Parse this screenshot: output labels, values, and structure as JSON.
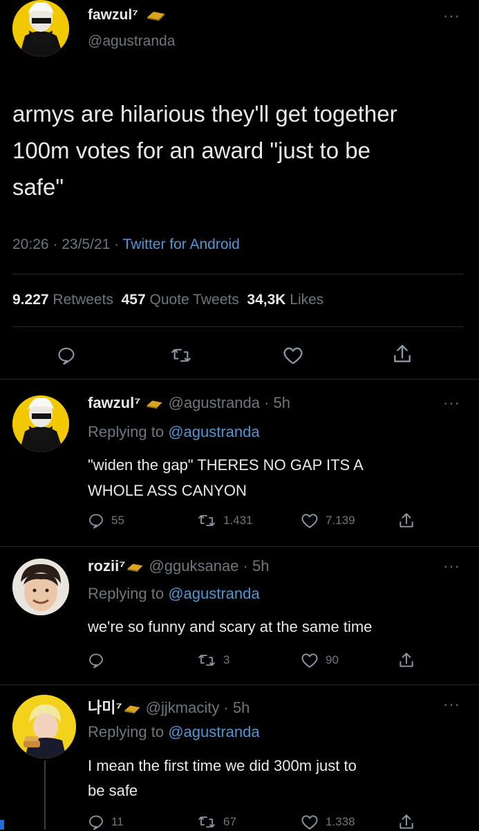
{
  "main_tweet": {
    "display_name": "fawzul⁷",
    "handle": "@agustranda",
    "text_lines": [
      "armys are hilarious they'll get together",
      "100m votes for an award \"just to be",
      "safe\""
    ],
    "time": "20:26",
    "date": "23/5/21",
    "source": "Twitter for Android",
    "stats": {
      "retweets_count": "9.227",
      "retweets_label": "Retweets",
      "quotes_count": "457",
      "quotes_label": "Quote Tweets",
      "likes_count": "34,3K",
      "likes_label": "Likes"
    }
  },
  "replies": [
    {
      "display_name": "fawzul⁷",
      "handle": "@agustranda",
      "age": "5h",
      "replying_prefix": "Replying to",
      "replying_to": "@agustranda",
      "text_lines": [
        "\"widen the gap\" THERES NO GAP ITS A",
        "WHOLE ASS CANYON"
      ],
      "replies_count": "55",
      "retweets_count": "1.431",
      "likes_count": "7.139"
    },
    {
      "display_name": "rozii⁷",
      "handle": "@gguksanae",
      "age": "5h",
      "replying_prefix": "Replying to",
      "replying_to": "@agustranda",
      "text_lines": [
        "we're so funny and scary at the same time"
      ],
      "replies_count": "",
      "retweets_count": "3",
      "likes_count": "90"
    },
    {
      "display_name": "나미⁷",
      "handle": "@jjkmacity",
      "age": "5h",
      "replying_prefix": "Replying to",
      "replying_to": "@agustranda",
      "text_lines": [
        "I mean the first time we did 300m just to",
        "be safe"
      ],
      "replies_count": "11",
      "retweets_count": "67",
      "likes_count": "1.338"
    }
  ],
  "colors": {
    "accent": "#4f96d6",
    "muted": "#6e767d",
    "background": "#000000",
    "gold": "#d9a520"
  },
  "icons": [
    "more-icon",
    "reply-icon",
    "retweet-icon",
    "like-icon",
    "share-icon",
    "gold-bar-icon"
  ]
}
